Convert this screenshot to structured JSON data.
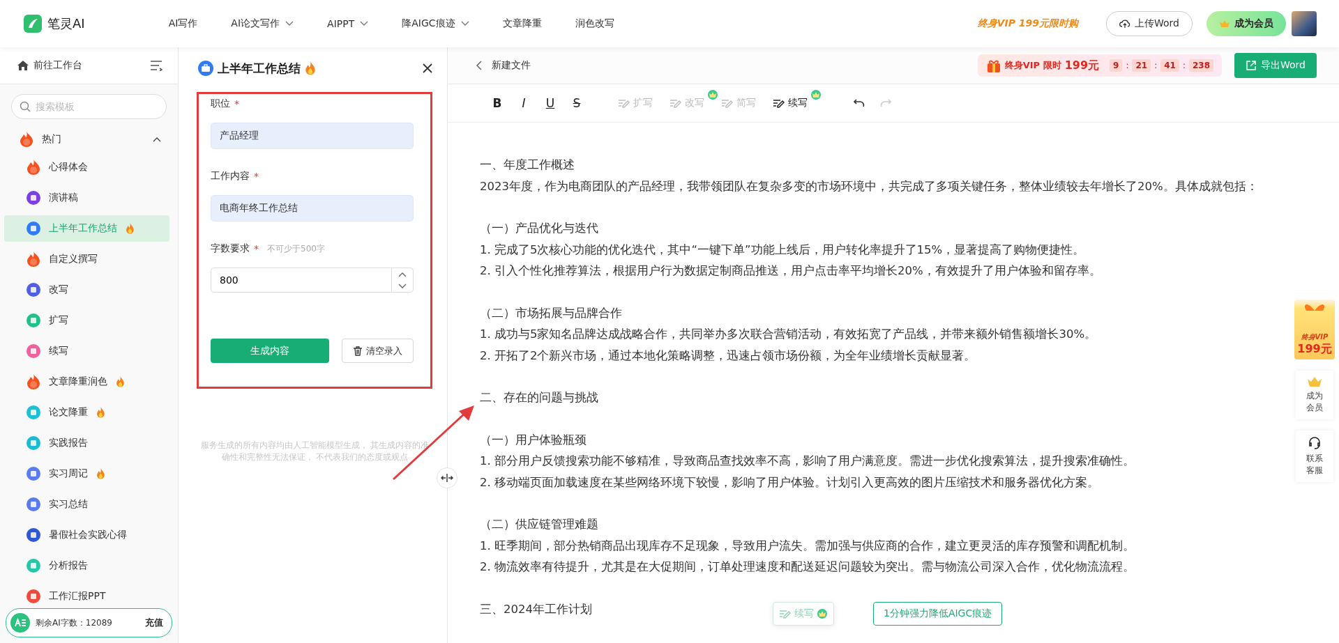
{
  "topbar": {
    "logo": "笔灵AI",
    "nav": [
      {
        "label": "AI写作",
        "dropdown": false
      },
      {
        "label": "AI论文写作",
        "dropdown": true
      },
      {
        "label": "AIPPT",
        "dropdown": true
      },
      {
        "label": "降AIGC痕迹",
        "dropdown": true
      },
      {
        "label": "文章降重",
        "dropdown": false
      },
      {
        "label": "润色改写",
        "dropdown": false
      }
    ],
    "promo": "终身VIP 199元限时购",
    "upload_button": "上传Word",
    "member_button": "成为会员"
  },
  "sidebar": {
    "workspace_link": "前往工作台",
    "search": {
      "placeholder": "搜索模板"
    },
    "section": {
      "label": "热门",
      "expanded": true,
      "items": [
        {
          "label": "心得体会",
          "kind": "trending",
          "color": "#f4511e",
          "hot": false,
          "selected": false
        },
        {
          "label": "演讲稿",
          "kind": "template",
          "color": "#7b3fe4",
          "hot": false,
          "selected": false
        },
        {
          "label": "上半年工作总结",
          "kind": "template",
          "color": "#2f7cf6",
          "hot": true,
          "selected": true
        },
        {
          "label": "自定义撰写",
          "kind": "trending",
          "color": "#f4511e",
          "hot": false,
          "selected": false
        },
        {
          "label": "改写",
          "kind": "template",
          "color": "#4f5de8",
          "hot": false,
          "selected": false
        },
        {
          "label": "扩写",
          "kind": "template",
          "color": "#22c08a",
          "hot": false,
          "selected": false
        },
        {
          "label": "续写",
          "kind": "template",
          "color": "#f0609e",
          "hot": false,
          "selected": false
        },
        {
          "label": "文章降重润色",
          "kind": "trending",
          "color": "#f4511e",
          "hot": true,
          "selected": false
        },
        {
          "label": "论文降重",
          "kind": "template",
          "color": "#18c1d6",
          "hot": true,
          "selected": false
        },
        {
          "label": "实践报告",
          "kind": "template",
          "color": "#19bcd4",
          "hot": false,
          "selected": false
        },
        {
          "label": "实习周记",
          "kind": "template",
          "color": "#5b7cf0",
          "hot": true,
          "selected": false
        },
        {
          "label": "实习总结",
          "kind": "template",
          "color": "#5a7bef",
          "hot": false,
          "selected": false
        },
        {
          "label": "暑假社会实践心得",
          "kind": "template",
          "color": "#2f56d6",
          "hot": false,
          "selected": false
        },
        {
          "label": "分析报告",
          "kind": "template",
          "color": "#26c6a8",
          "hot": false,
          "selected": false
        },
        {
          "label": "工作汇报PPT",
          "kind": "template",
          "color": "#f04a3a",
          "hot": false,
          "selected": false
        }
      ]
    },
    "quota": {
      "label": "剩余AI字数：",
      "value": "12089",
      "action": "充值"
    }
  },
  "form": {
    "title": "上半年工作总结",
    "hot": true,
    "required_mark": "*",
    "fields": [
      {
        "label": "职位",
        "required": true,
        "value": "产品经理",
        "kind": "text"
      },
      {
        "label": "工作内容",
        "required": true,
        "value": "电商年终工作总结",
        "kind": "text"
      },
      {
        "label": "字数要求",
        "required": true,
        "hint": "不可少于500字",
        "value": "800",
        "kind": "number"
      }
    ],
    "generate_button": "生成内容",
    "clear_button": "清空录入",
    "disclaimer": "服务生成的所有内容均由人工智能模型生成， 其生成内容的准确性和完整性无法保证， 不代表我们的态度或观点"
  },
  "editor": {
    "file_name": "新建文件",
    "promo": {
      "label": "终身VIP 限时",
      "price": "199元",
      "timer": [
        "9",
        "21",
        "41",
        "238"
      ],
      "separator": ":"
    },
    "export_button": "导出Word",
    "toolbar": [
      {
        "kind": "format",
        "label": "B"
      },
      {
        "kind": "format",
        "label": "I"
      },
      {
        "kind": "format",
        "label": "U"
      },
      {
        "kind": "format",
        "label": "S"
      },
      {
        "kind": "ai",
        "label": "扩写",
        "disabled": true,
        "premium": false
      },
      {
        "kind": "ai",
        "label": "改写",
        "disabled": true,
        "premium": true
      },
      {
        "kind": "ai",
        "label": "简写",
        "disabled": true,
        "premium": false
      },
      {
        "kind": "ai",
        "label": "续写",
        "disabled": false,
        "premium": true
      },
      {
        "kind": "undo",
        "disabled": false
      },
      {
        "kind": "redo",
        "disabled": true
      }
    ],
    "document": [
      [
        "一、年度工作概述",
        "2023年度，作为电商团队的产品经理，我带领团队在复杂多变的市场环境中，共完成了多项关键任务，整体业绩较去年增长了20%。具体成就包括："
      ],
      [
        "（一）产品优化与迭代",
        "1. 完成了5次核心功能的优化迭代，其中“一键下单”功能上线后，用户转化率提升了15%，显著提高了购物便捷性。",
        "2. 引入个性化推荐算法，根据用户行为数据定制商品推送，用户点击率平均增长20%，有效提升了用户体验和留存率。"
      ],
      [
        "（二）市场拓展与品牌合作",
        "1. 成功与5家知名品牌达成战略合作，共同举办多次联合营销活动，有效拓宽了产品线，并带来额外销售额增长30%。",
        "2. 开拓了2个新兴市场，通过本地化策略调整，迅速占领市场份额，为全年业绩增长贡献显著。"
      ],
      [
        "二、存在的问题与挑战"
      ],
      [
        "（一）用户体验瓶颈",
        "1. 部分用户反馈搜索功能不够精准，导致商品查找效率不高，影响了用户满意度。需进一步优化搜索算法，提升搜索准确性。",
        "2. 移动端页面加载速度在某些网络环境下较慢，影响了用户体验。计划引入更高效的图片压缩技术和服务器优化方案。"
      ],
      [
        "（二）供应链管理难题",
        "1. 旺季期间，部分热销商品出现库存不足现象，导致用户流失。需加强与供应商的合作，建立更灵活的库存预警和调配机制。",
        "2. 物流效率有待提升，尤其是在大促期间，订单处理速度和配送延迟问题较为突出。需与物流公司深入合作，优化物流流程。"
      ],
      [
        "三、2024年工作计划"
      ]
    ],
    "continue_button": "续写",
    "deaigc_button": "1分钟强力降低AIGC痕迹"
  },
  "side_float": {
    "promo_top": "终身VIP",
    "promo_price": "199元",
    "member": "成为会员",
    "service": "联系客服"
  }
}
